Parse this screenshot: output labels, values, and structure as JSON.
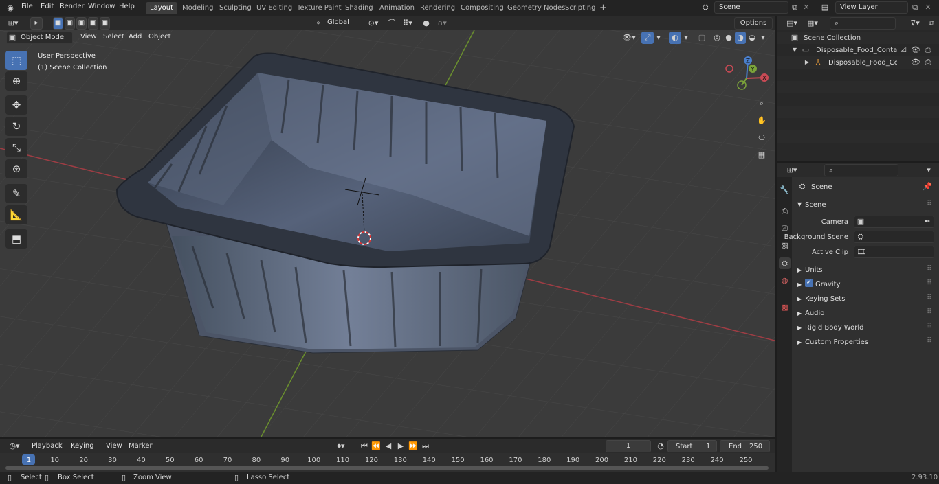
{
  "topbar": {
    "menus": [
      "File",
      "Edit",
      "Render",
      "Window",
      "Help"
    ],
    "workspaces": [
      "Layout",
      "Modeling",
      "Sculpting",
      "UV Editing",
      "Texture Paint",
      "Shading",
      "Animation",
      "Rendering",
      "Compositing",
      "Geometry Nodes",
      "Scripting"
    ],
    "active_workspace": "Layout",
    "add_tab": "+",
    "scene_name": "Scene",
    "view_layer": "View Layer"
  },
  "viewport_header": {
    "orientation": "Global",
    "options_label": "Options",
    "mode": "Object Mode",
    "menus": [
      "View",
      "Select",
      "Add",
      "Object"
    ]
  },
  "viewport": {
    "perspective_label": "User Perspective",
    "collection_label": "(1) Scene Collection",
    "gizmo_axes": {
      "x": "X",
      "y": "Y",
      "z": "Z"
    }
  },
  "outliner": {
    "root": "Scene Collection",
    "items": [
      {
        "label": "Disposable_Food_Container_v"
      },
      {
        "label": "Disposable_Food_Contai"
      }
    ]
  },
  "properties": {
    "context_title": "Scene",
    "panel_title": "Scene",
    "fields": [
      {
        "label": "Camera"
      },
      {
        "label": "Background Scene"
      },
      {
        "label": "Active Clip"
      }
    ],
    "sections": [
      "Units",
      "Gravity",
      "Keying Sets",
      "Audio",
      "Rigid Body World",
      "Custom Properties"
    ]
  },
  "timeline": {
    "menus": [
      "Playback",
      "Keying",
      "View",
      "Marker"
    ],
    "current_frame": "1",
    "start_label": "Start",
    "start_value": "1",
    "end_label": "End",
    "end_value": "250",
    "ticks": [
      "1",
      "10",
      "20",
      "30",
      "40",
      "50",
      "60",
      "70",
      "80",
      "90",
      "100",
      "110",
      "120",
      "130",
      "140",
      "150",
      "160",
      "170",
      "180",
      "190",
      "200",
      "210",
      "220",
      "230",
      "240",
      "250"
    ]
  },
  "statusbar": {
    "select": "Select",
    "box_select": "Box Select",
    "zoom_view": "Zoom View",
    "lasso_select": "Lasso Select",
    "version": "2.93.10"
  },
  "colors": {
    "accent": "#4772b3",
    "active_tab": "#3d3d3d",
    "x_axis": "#c94a55",
    "y_axis": "#7ba33a",
    "z_axis": "#4a7fcc"
  }
}
